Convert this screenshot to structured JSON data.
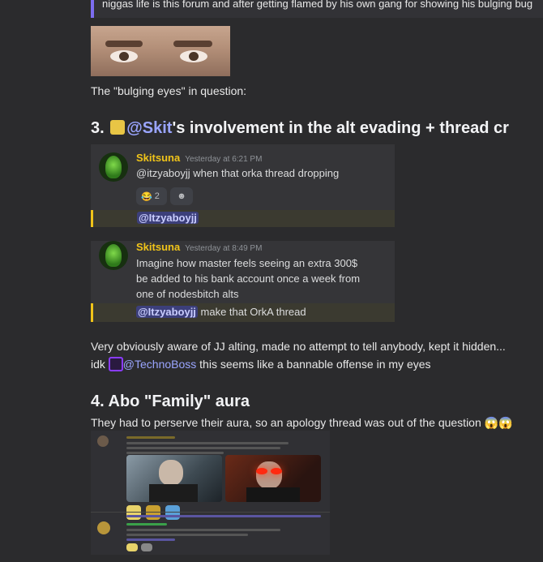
{
  "quote": {
    "text": "niggas life is this forum and after getting flamed by his own gang for showing his bulging bug"
  },
  "bulging_caption": "The \"bulging eyes\" in question:",
  "section3": {
    "number": "3.",
    "mention": "@Skit",
    "title_rest": "'s involvement in the alt evading + thread cr"
  },
  "msg1": {
    "username": "Skitsuna",
    "timestamp": "Yesterday at 6:21 PM",
    "text": "@itzyaboyjj when that orka thread dropping",
    "reaction_count": "2",
    "reaction_emoji": "😂",
    "reaction_add_icon": "☻"
  },
  "mention_bar1": "@Itzyaboyjj",
  "msg2": {
    "username": "Skitsuna",
    "timestamp": "Yesterday at 8:49 PM",
    "lines": [
      "Imagine how master feels seeing an extra 300$",
      "be added to his bank account once a week from",
      "one of nodesbitch alts"
    ],
    "mention": "@Itzyaboyjj",
    "mention_rest": " make that OrkA thread"
  },
  "para1": "Very obviously aware of JJ alting, made no attempt to tell anybody, kept it hidden...",
  "para2": {
    "prefix": "idk",
    "mention": "@TechnoBoss",
    "rest": " this seems like a bannable offense in my eyes"
  },
  "section4": {
    "title": "4. Abo \"Family\" aura"
  },
  "para3": {
    "text": "They had to perserve their aura, so an apology thread was out of the question",
    "emojis": "😱😱"
  },
  "colors": {
    "accent": "#7d6df0",
    "username": "#f0c419",
    "mention": "#9aa5ff",
    "background": "#2b2b2d"
  }
}
